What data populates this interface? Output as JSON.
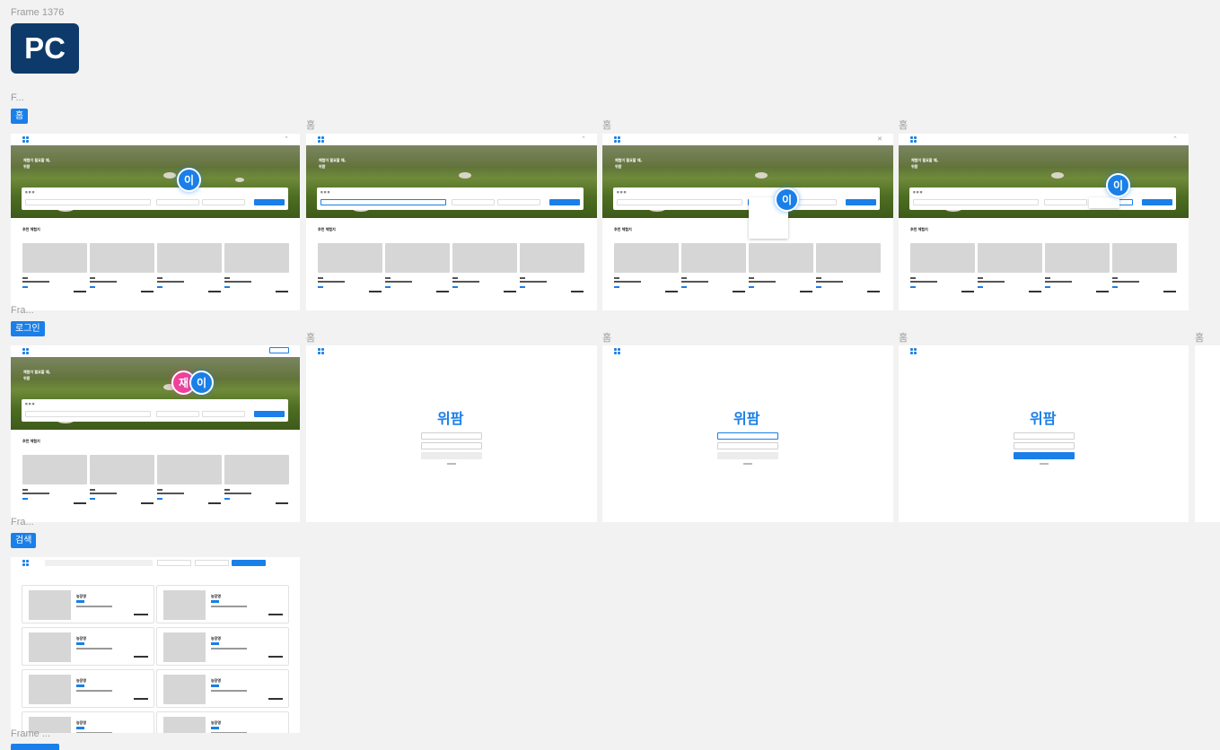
{
  "canvas": {
    "frame_label": "Frame 1376",
    "platform_badge": "PC",
    "group_label_short": "F...",
    "group_label_fra": "Fra...",
    "frame_label_trunc": "Frame ..."
  },
  "sections": {
    "home": "홈",
    "login": "로그인",
    "search": "검색"
  },
  "frame_titles": {
    "home": "홈"
  },
  "home_frame": {
    "hero_title_line1": "체험이 필요할 때,",
    "hero_title_line2": "위팜",
    "recommend_title": "추천 체험지"
  },
  "login_frame": {
    "logo": "위팜"
  },
  "search_frame": {
    "item_title": "농장명"
  },
  "avatars": {
    "user_a": "이",
    "user_b": "재"
  },
  "colors": {
    "accent": "#1a7fe8",
    "pc_tile": "#0d3a6b",
    "avatar_pink": "#f0409a"
  }
}
